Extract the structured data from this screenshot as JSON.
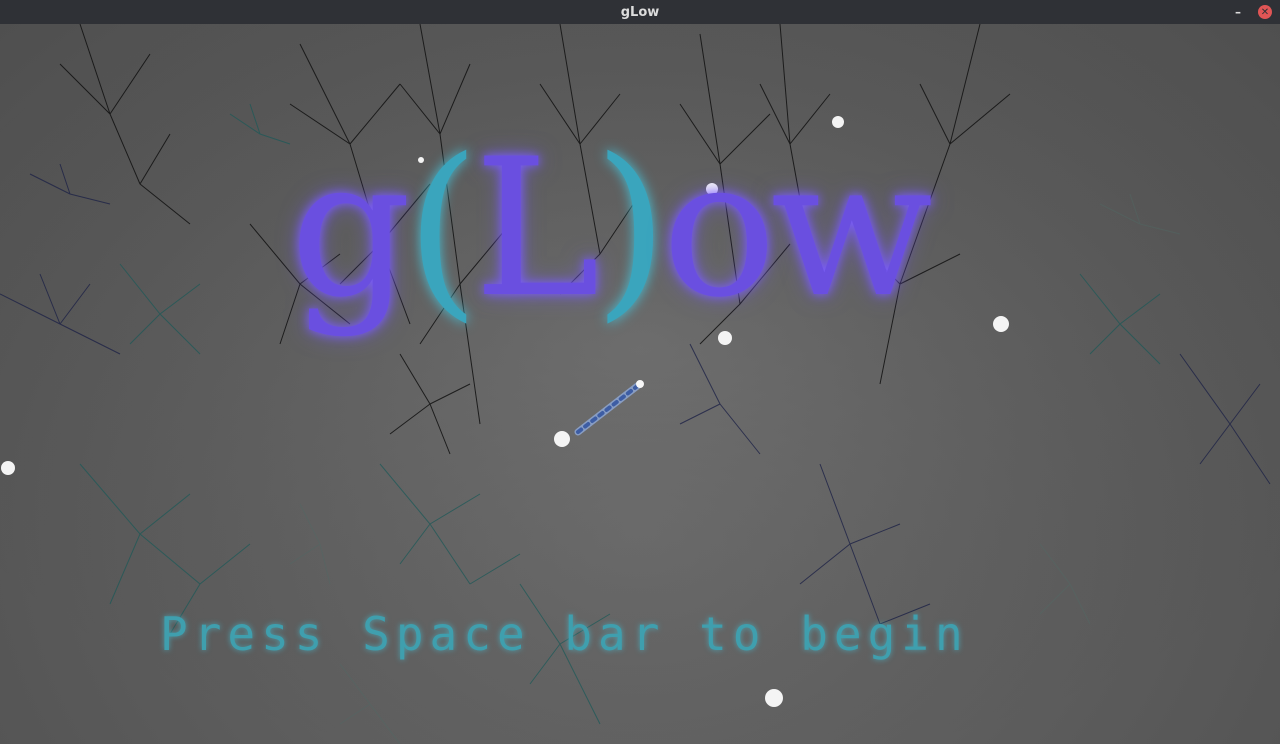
{
  "window": {
    "title": "gLow",
    "minimize_label": "–",
    "close_label": "✕"
  },
  "game": {
    "logo": {
      "g": "g",
      "open_paren": "(",
      "L": "L",
      "close_paren": ")",
      "ow": "ow"
    },
    "prompt": "Press Space bar to begin",
    "colors": {
      "logo": "#6a4fe0",
      "logo_paren": "#3aa5bd",
      "prompt": "#3f9fae",
      "background": "#5a5a5a"
    }
  }
}
